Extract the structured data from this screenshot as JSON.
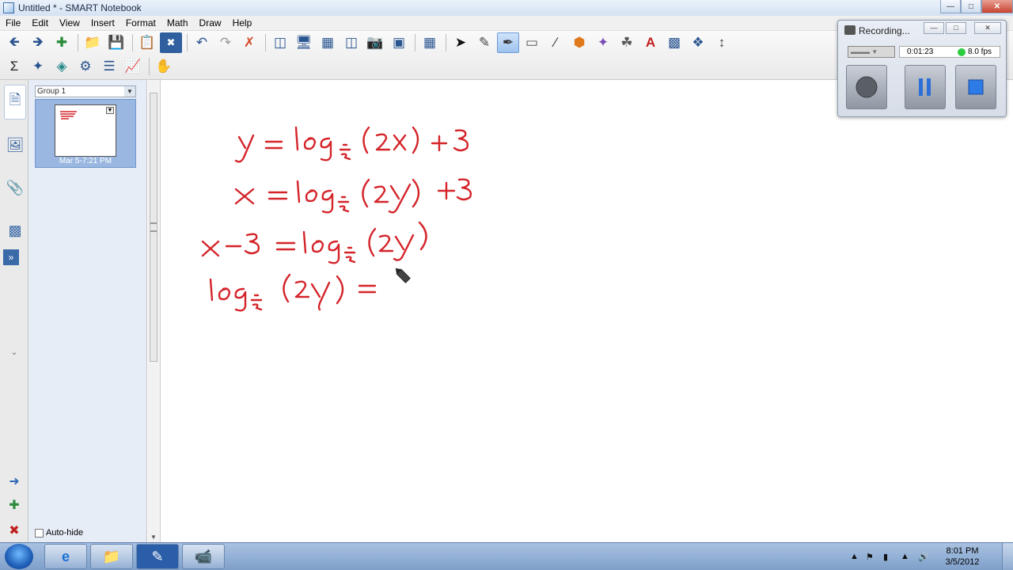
{
  "window": {
    "title": "Untitled * - SMART Notebook",
    "icons": {
      "minimize": "minimize-icon",
      "maximize": "maximize-icon",
      "close": "close-icon"
    }
  },
  "menu": {
    "items": [
      "File",
      "Edit",
      "View",
      "Insert",
      "Format",
      "Math",
      "Draw",
      "Help"
    ]
  },
  "toolbar": {
    "row1": [
      "back-arrow-icon",
      "forward-arrow-icon",
      "add-page-icon",
      "|",
      "open-folder-icon",
      "save-disk-icon",
      "|",
      "paste-icon",
      "delete-x-icon",
      "|",
      "undo-icon",
      "redo-icon",
      "cancel-x-icon",
      "|",
      "screen-shade-icon",
      "full-screen-icon",
      "transparent-bg-icon",
      "dual-page-icon",
      "screen-capture-icon",
      "document-camera-icon",
      "|",
      "table-icon",
      "|",
      "select-arrow-icon",
      "pen-icon",
      "creative-pen-icon",
      "eraser-icon",
      "line-icon",
      "shape-icon",
      "magic-pen-icon",
      "fill-icon",
      "text-icon",
      "properties-icon",
      "move-toolbar-icon",
      "arrows-updown-icon"
    ],
    "row2": [
      "sigma-icon",
      "shape-recognition-icon",
      "3d-tools-icon",
      "activity-builder-icon",
      "table-tools-icon",
      "graph-icon",
      "|",
      "response-icon"
    ],
    "active": "creative-pen-icon"
  },
  "sidebar": {
    "tabs": [
      "page-sorter-icon",
      "gallery-icon",
      "attachments-icon",
      "properties-icon"
    ],
    "expand_icon": "double-chevron-right-icon",
    "group_label": "Group 1",
    "page_date": "Mar 5-7:21 PM",
    "autohide_label": "Auto-hide"
  },
  "canvas": {
    "ink_color": "#d4242a",
    "line1": "y = log_{1/2}(2x) + 3",
    "line2": "x = log_{1/2}(2y) + 3",
    "line3": "x - 3 = log_{1/2}(2y)",
    "line4": "log_{1/2}(2y) ="
  },
  "recorder": {
    "title": "Recording...",
    "time": "0:01:23",
    "fps": "8.0 fps",
    "status_color": "#2ecc40"
  },
  "taskbar": {
    "time": "8:01 PM",
    "date": "3/5/2012",
    "apps": [
      "internet-explorer-icon",
      "file-explorer-icon",
      "smart-notebook-icon",
      "recorder-app-icon"
    ]
  }
}
